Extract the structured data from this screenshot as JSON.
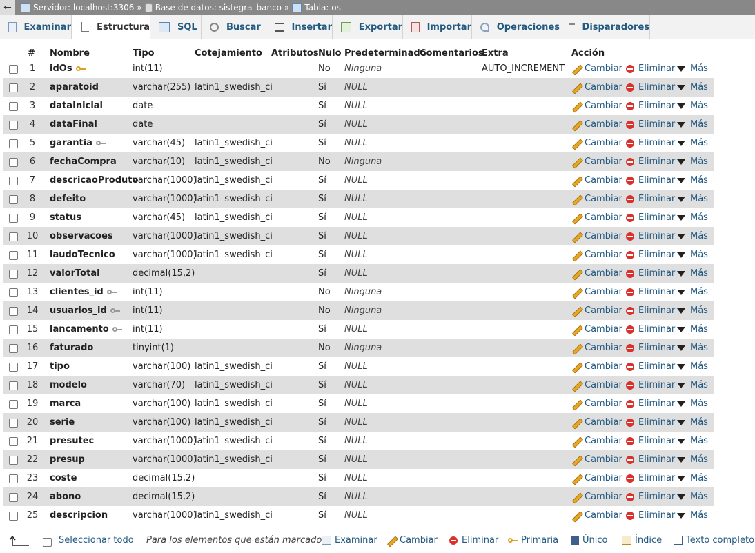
{
  "breadcrumb": {
    "server": "Servidor: localhost:3306",
    "database": "Base de datos: sistegra_banco",
    "table": "Tabla: os",
    "separator": "»",
    "back": "←"
  },
  "tabs": [
    {
      "label": "Examinar",
      "icon": "browse-icon"
    },
    {
      "label": "Estructura",
      "icon": "structure-icon"
    },
    {
      "label": "SQL",
      "icon": "sql-icon"
    },
    {
      "label": "Buscar",
      "icon": "search-icon"
    },
    {
      "label": "Insertar",
      "icon": "insert-icon"
    },
    {
      "label": "Exportar",
      "icon": "export-icon"
    },
    {
      "label": "Importar",
      "icon": "import-icon"
    },
    {
      "label": "Operaciones",
      "icon": "wrench-icon"
    },
    {
      "label": "Disparadores",
      "icon": "triggers-icon"
    }
  ],
  "columns": {
    "num": "#",
    "name": "Nombre",
    "type": "Tipo",
    "collation": "Cotejamiento",
    "attributes": "Atributos",
    "null": "Nulo",
    "default": "Predeterminado",
    "comments": "Comentarios",
    "extra": "Extra",
    "action": "Acción"
  },
  "actions": {
    "change": "Cambiar",
    "drop": "Eliminar",
    "more": "Más"
  },
  "rows": [
    {
      "n": "1",
      "name": "idOs",
      "key": "primary",
      "type": "int(11)",
      "collation": "",
      "null": "No",
      "default": "Ninguna",
      "extra": "AUTO_INCREMENT"
    },
    {
      "n": "2",
      "name": "aparatoid",
      "key": "",
      "type": "varchar(255)",
      "collation": "latin1_swedish_ci",
      "null": "Sí",
      "default": "NULL",
      "extra": ""
    },
    {
      "n": "3",
      "name": "dataInicial",
      "key": "",
      "type": "date",
      "collation": "",
      "null": "Sí",
      "default": "NULL",
      "extra": ""
    },
    {
      "n": "4",
      "name": "dataFinal",
      "key": "",
      "type": "date",
      "collation": "",
      "null": "Sí",
      "default": "NULL",
      "extra": ""
    },
    {
      "n": "5",
      "name": "garantia",
      "key": "index",
      "type": "varchar(45)",
      "collation": "latin1_swedish_ci",
      "null": "Sí",
      "default": "NULL",
      "extra": ""
    },
    {
      "n": "6",
      "name": "fechaCompra",
      "key": "",
      "type": "varchar(10)",
      "collation": "latin1_swedish_ci",
      "null": "No",
      "default": "Ninguna",
      "extra": ""
    },
    {
      "n": "7",
      "name": "descricaoProduto",
      "key": "",
      "type": "varchar(1000)",
      "collation": "latin1_swedish_ci",
      "null": "Sí",
      "default": "NULL",
      "extra": ""
    },
    {
      "n": "8",
      "name": "defeito",
      "key": "",
      "type": "varchar(1000)",
      "collation": "latin1_swedish_ci",
      "null": "Sí",
      "default": "NULL",
      "extra": ""
    },
    {
      "n": "9",
      "name": "status",
      "key": "",
      "type": "varchar(45)",
      "collation": "latin1_swedish_ci",
      "null": "Sí",
      "default": "NULL",
      "extra": ""
    },
    {
      "n": "10",
      "name": "observacoes",
      "key": "",
      "type": "varchar(1000)",
      "collation": "latin1_swedish_ci",
      "null": "Sí",
      "default": "NULL",
      "extra": ""
    },
    {
      "n": "11",
      "name": "laudoTecnico",
      "key": "",
      "type": "varchar(1000)",
      "collation": "latin1_swedish_ci",
      "null": "Sí",
      "default": "NULL",
      "extra": ""
    },
    {
      "n": "12",
      "name": "valorTotal",
      "key": "",
      "type": "decimal(15,2)",
      "collation": "",
      "null": "Sí",
      "default": "NULL",
      "extra": ""
    },
    {
      "n": "13",
      "name": "clientes_id",
      "key": "index",
      "type": "int(11)",
      "collation": "",
      "null": "No",
      "default": "Ninguna",
      "extra": ""
    },
    {
      "n": "14",
      "name": "usuarios_id",
      "key": "index",
      "type": "int(11)",
      "collation": "",
      "null": "No",
      "default": "Ninguna",
      "extra": ""
    },
    {
      "n": "15",
      "name": "lancamento",
      "key": "index",
      "type": "int(11)",
      "collation": "",
      "null": "Sí",
      "default": "NULL",
      "extra": ""
    },
    {
      "n": "16",
      "name": "faturado",
      "key": "",
      "type": "tinyint(1)",
      "collation": "",
      "null": "No",
      "default": "Ninguna",
      "extra": ""
    },
    {
      "n": "17",
      "name": "tipo",
      "key": "",
      "type": "varchar(100)",
      "collation": "latin1_swedish_ci",
      "null": "Sí",
      "default": "NULL",
      "extra": ""
    },
    {
      "n": "18",
      "name": "modelo",
      "key": "",
      "type": "varchar(70)",
      "collation": "latin1_swedish_ci",
      "null": "Sí",
      "default": "NULL",
      "extra": ""
    },
    {
      "n": "19",
      "name": "marca",
      "key": "",
      "type": "varchar(100)",
      "collation": "latin1_swedish_ci",
      "null": "Sí",
      "default": "NULL",
      "extra": ""
    },
    {
      "n": "20",
      "name": "serie",
      "key": "",
      "type": "varchar(100)",
      "collation": "latin1_swedish_ci",
      "null": "Sí",
      "default": "NULL",
      "extra": ""
    },
    {
      "n": "21",
      "name": "presutec",
      "key": "",
      "type": "varchar(1000)",
      "collation": "latin1_swedish_ci",
      "null": "Sí",
      "default": "NULL",
      "extra": ""
    },
    {
      "n": "22",
      "name": "presup",
      "key": "",
      "type": "varchar(1000)",
      "collation": "latin1_swedish_ci",
      "null": "Sí",
      "default": "NULL",
      "extra": ""
    },
    {
      "n": "23",
      "name": "coste",
      "key": "",
      "type": "decimal(15,2)",
      "collation": "",
      "null": "Sí",
      "default": "NULL",
      "extra": ""
    },
    {
      "n": "24",
      "name": "abono",
      "key": "",
      "type": "decimal(15,2)",
      "collation": "",
      "null": "Sí",
      "default": "NULL",
      "extra": ""
    },
    {
      "n": "25",
      "name": "descripcion",
      "key": "",
      "type": "varchar(1000)",
      "collation": "latin1_swedish_ci",
      "null": "Sí",
      "default": "NULL",
      "extra": ""
    }
  ],
  "footer": {
    "select_all": "Seleccionar todo",
    "with_selected": "Para los elementos que están marcados:",
    "browse": "Examinar",
    "change": "Cambiar",
    "drop": "Eliminar",
    "primary": "Primaria",
    "unique": "Único",
    "index": "Índice",
    "fulltext": "Texto completo"
  },
  "colors": {
    "link": "#235a81",
    "row_alt": "#dfdfdf",
    "drop_icon": "#d9312b",
    "key_icon": "#d7a523"
  }
}
